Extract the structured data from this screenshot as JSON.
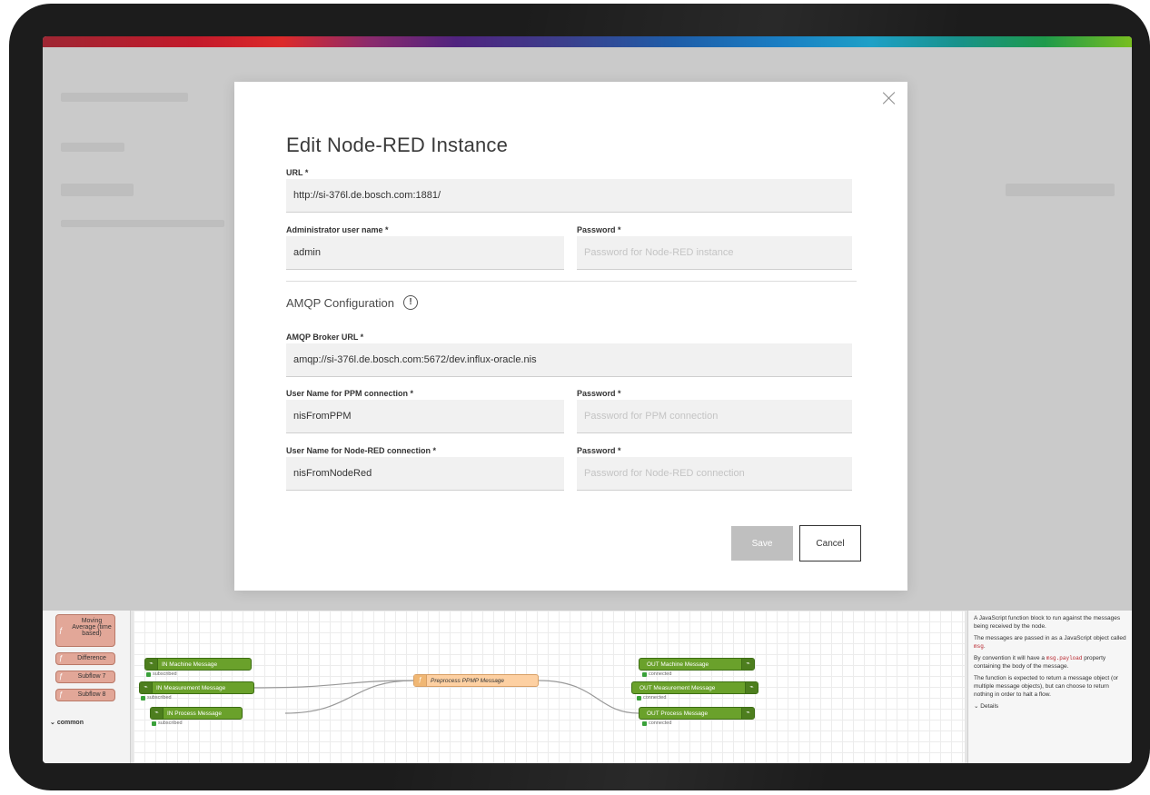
{
  "modal": {
    "title": "Edit Node-RED Instance",
    "url_label": "URL *",
    "url_value": "http://si-376l.de.bosch.com:1881/",
    "admin_label": "Administrator user name *",
    "admin_value": "admin",
    "password_label": "Password *",
    "password_placeholder": "Password for Node-RED instance",
    "amqp_section": "AMQP Configuration",
    "broker_label": "AMQP Broker URL *",
    "broker_value": "amqp://si-376l.de.bosch.com:5672/dev.influx-oracle.nis",
    "ppm_user_label": "User Name for PPM connection *",
    "ppm_user_value": "nisFromPPM",
    "ppm_password_label": "Password *",
    "ppm_password_placeholder": "Password for PPM connection",
    "nr_user_label": "User Name for Node-RED connection *",
    "nr_user_value": "nisFromNodeRed",
    "nr_password_label": "Password *",
    "nr_password_placeholder": "Password for Node-RED connection",
    "save_label": "Save",
    "cancel_label": "Cancel"
  },
  "palette": {
    "nodes": [
      "Moving Average (time based)",
      "Difference",
      "Subflow 7",
      "Subflow 8"
    ],
    "category": "common"
  },
  "flow": {
    "in_nodes": [
      "IN Machine Message",
      "IN Measurement Message",
      "IN Process Message"
    ],
    "in_status": "subscribed",
    "function_node": "Preprocess PPMP Message",
    "out_nodes": [
      "OUT Machine Message",
      "OUT Measurement Message",
      "OUT Process Message"
    ],
    "out_status": "connected"
  },
  "info": {
    "p1": "A JavaScript function block to run against the messages being received by the node.",
    "p2a": "The messages are passed in as a JavaScript object called ",
    "p2code": "msg",
    "p3a": "By convention it will have a ",
    "p3code": "msg.payload",
    "p3b": " property containing the body of the message.",
    "p4": "The function is expected to return a message object (or multiple message objects), but can choose to return nothing in order to halt a flow.",
    "details": "Details"
  }
}
